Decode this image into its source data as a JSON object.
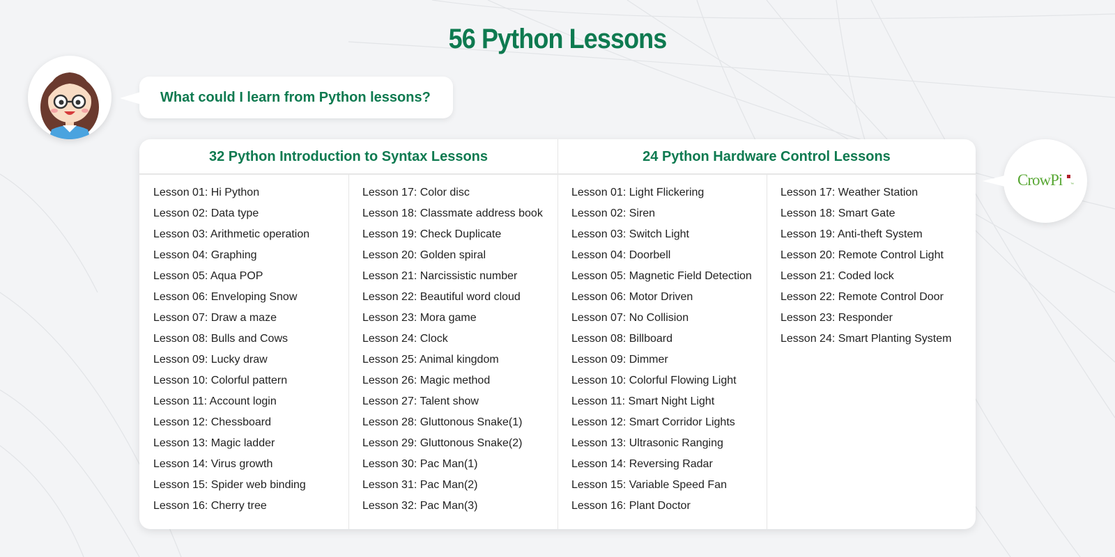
{
  "page": {
    "title": "56 Python Lessons",
    "question": "What could I learn from Python lessons?"
  },
  "logo": {
    "text": "CrowPi",
    "mark": "™"
  },
  "colors": {
    "accent": "#0e7a50",
    "logo_green": "#5aa836",
    "logo_red": "#b01e2a"
  },
  "icons": [
    "girl-avatar-icon",
    "crowpi-logo"
  ],
  "sections": [
    {
      "title": "32 Python Introduction to Syntax Lessons",
      "columns": [
        [
          "Lesson 01: Hi Python",
          "Lesson 02: Data type",
          "Lesson 03: Arithmetic operation",
          "Lesson 04: Graphing",
          "Lesson 05: Aqua POP",
          "Lesson 06: Enveloping Snow",
          "Lesson 07: Draw a maze",
          "Lesson 08: Bulls and Cows",
          "Lesson 09: Lucky draw",
          "Lesson 10: Colorful pattern",
          "Lesson 11: Account login",
          "Lesson 12: Chessboard",
          "Lesson 13: Magic ladder",
          "Lesson 14: Virus growth",
          "Lesson 15: Spider web binding",
          "Lesson 16: Cherry tree"
        ],
        [
          "Lesson 17: Color disc",
          "Lesson 18: Classmate address book",
          "Lesson 19: Check Duplicate",
          "Lesson 20: Golden spiral",
          "Lesson 21: Narcissistic number",
          "Lesson 22: Beautiful word cloud",
          "Lesson 23: Mora game",
          "Lesson 24: Clock",
          "Lesson 25: Animal kingdom",
          "Lesson 26: Magic method",
          "Lesson 27: Talent show",
          "Lesson 28: Gluttonous Snake(1)",
          "Lesson 29: Gluttonous Snake(2)",
          "Lesson 30: Pac Man(1)",
          "Lesson 31: Pac Man(2)",
          "Lesson 32: Pac Man(3)"
        ]
      ]
    },
    {
      "title": "24 Python Hardware Control Lessons",
      "columns": [
        [
          "Lesson 01: Light Flickering",
          "Lesson 02: Siren",
          "Lesson 03: Switch Light",
          "Lesson 04: Doorbell",
          "Lesson 05: Magnetic Field Detection",
          "Lesson 06: Motor Driven",
          "Lesson 07: No Collision",
          "Lesson 08: Billboard",
          "Lesson 09: Dimmer",
          "Lesson 10: Colorful Flowing Light",
          "Lesson 11: Smart Night Light",
          "Lesson 12: Smart Corridor Lights",
          "Lesson 13: Ultrasonic Ranging",
          "Lesson 14: Reversing Radar",
          "Lesson 15: Variable Speed Fan",
          "Lesson 16: Plant Doctor"
        ],
        [
          "Lesson 17: Weather Station",
          "Lesson 18: Smart Gate",
          "Lesson 19: Anti-theft System",
          "Lesson 20: Remote Control Light",
          "Lesson 21: Coded lock",
          "Lesson 22: Remote Control Door",
          "Lesson 23: Responder",
          "Lesson 24: Smart Planting System"
        ]
      ]
    }
  ]
}
